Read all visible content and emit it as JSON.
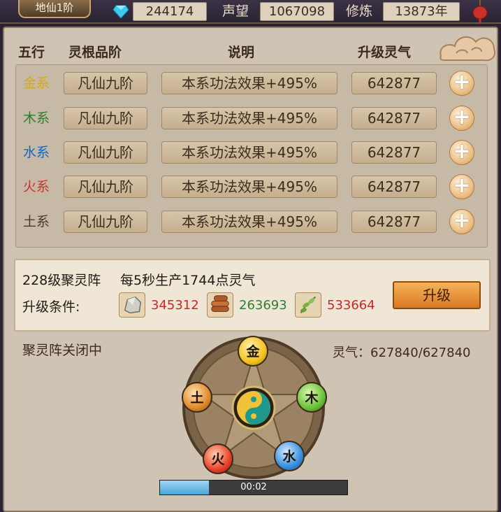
{
  "topbar": {
    "rank": "地仙1阶",
    "gems": "244174",
    "prestige_label": "声望",
    "prestige": "1067098",
    "cultivate_label": "修炼",
    "cultivate": "13873年"
  },
  "table": {
    "headers": {
      "element": "五行",
      "grade": "灵根品阶",
      "desc": "说明",
      "cost": "升级灵气"
    },
    "rows": [
      {
        "element": "金系",
        "color": "#e0a800",
        "grade": "凡仙九阶",
        "desc": "本系功法效果+495%",
        "cost": "642877"
      },
      {
        "element": "木系",
        "color": "#2e7d32",
        "grade": "凡仙九阶",
        "desc": "本系功法效果+495%",
        "cost": "642877"
      },
      {
        "element": "水系",
        "color": "#1565c0",
        "grade": "凡仙九阶",
        "desc": "本系功法效果+495%",
        "cost": "642877"
      },
      {
        "element": "火系",
        "color": "#d32f2f",
        "grade": "凡仙九阶",
        "desc": "本系功法效果+495%",
        "cost": "642877"
      },
      {
        "element": "土系",
        "color": "#4a3a2a",
        "grade": "凡仙九阶",
        "desc": "本系功法效果+495%",
        "cost": "642877"
      }
    ]
  },
  "array": {
    "title": "228级聚灵阵",
    "production": "每5秒生产1744点灵气",
    "condition_label": "升级条件:",
    "resources": [
      {
        "icon": "stone-icon",
        "value": "345312",
        "color": "#c62828"
      },
      {
        "icon": "wood-icon",
        "value": "263693",
        "color": "#2e7d32"
      },
      {
        "icon": "herb-icon",
        "value": "533664",
        "color": "#c62828"
      }
    ],
    "upgrade_label": "升级"
  },
  "status": {
    "closed": "聚灵阵关闭中",
    "energy": "灵气：627840/627840"
  },
  "wheel": {
    "orbs": [
      {
        "label": "金",
        "color": "#f4c21e"
      },
      {
        "label": "木",
        "color": "#6cc23a"
      },
      {
        "label": "水",
        "color": "#3a8fe0"
      },
      {
        "label": "火",
        "color": "#e8422a"
      },
      {
        "label": "土",
        "color": "#e08a2c"
      }
    ]
  },
  "timer": {
    "text": "00:02",
    "progress": 0.26
  }
}
